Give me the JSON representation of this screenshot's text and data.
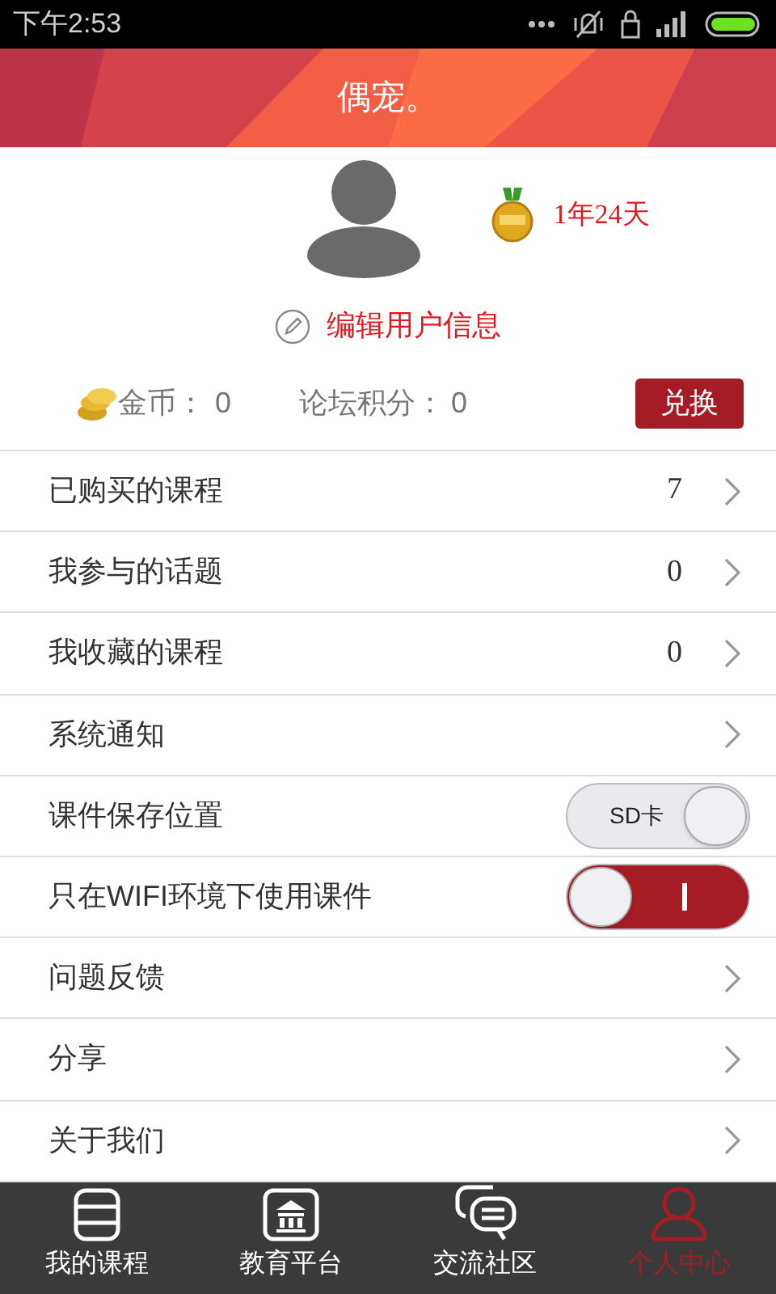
{
  "status_bar": {
    "time": "下午2:53"
  },
  "header": {
    "title": "偶宠。"
  },
  "profile": {
    "vip_period": "1年24天",
    "edit_label": "编辑用户信息",
    "coins_label": "金币：",
    "coins": "0",
    "points_label": "论坛积分：",
    "points": "0",
    "redeem_button": "兑换"
  },
  "menu": [
    {
      "kind": "count",
      "label": "已购买的课程",
      "count": "7"
    },
    {
      "kind": "count",
      "label": "我参与的话题",
      "count": "0"
    },
    {
      "kind": "count",
      "label": "我收藏的课程",
      "count": "0"
    },
    {
      "kind": "link",
      "label": "系统通知"
    },
    {
      "kind": "toggle",
      "label": "课件保存位置",
      "on": false,
      "switch_label": "SD卡"
    },
    {
      "kind": "toggle",
      "label": "只在WIFI环境下使用课件",
      "on": true
    },
    {
      "kind": "link",
      "label": "问题反馈"
    },
    {
      "kind": "link",
      "label": "分享"
    },
    {
      "kind": "link",
      "label": "关于我们"
    }
  ],
  "tabs": [
    {
      "kind": "book",
      "label": "我的课程",
      "selected": false
    },
    {
      "kind": "bank",
      "label": "教育平台",
      "selected": false
    },
    {
      "kind": "chat",
      "label": "交流社区",
      "selected": false
    },
    {
      "kind": "person",
      "label": "个人中心",
      "selected": true
    }
  ]
}
